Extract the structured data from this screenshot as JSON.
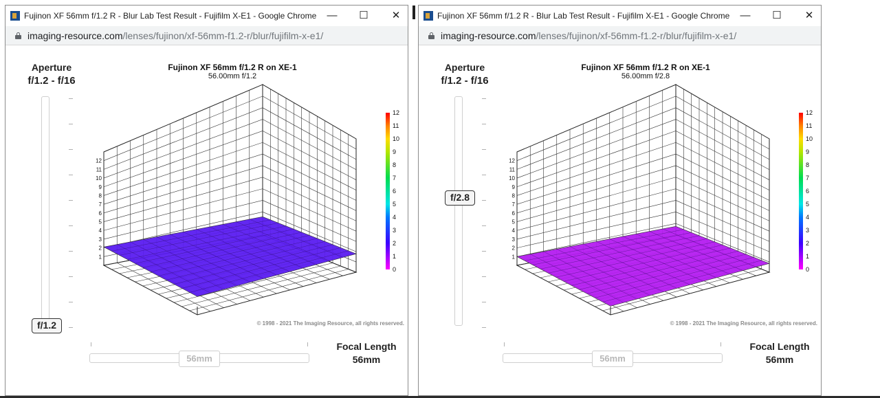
{
  "windows": [
    {
      "title": "Fujinon XF 56mm f/1.2 R - Blur Lab Test Result - Fujifilm X-E1 - Google Chrome",
      "url_host": "imaging-resource.com",
      "url_path": "/lenses/fujinon/xf-56mm-f1.2-r/blur/fujifilm-x-e1/",
      "aperture": {
        "title": "Aperture",
        "range": "f/1.2 - f/16",
        "selected": "f/1.2",
        "slider_fraction": 1.0
      },
      "focal_length": {
        "title": "Focal Length",
        "value": "56mm",
        "handle_label": "56mm"
      },
      "chart_data": {
        "type": "surface3d",
        "title": "Fujinon XF 56mm f/1.2 R on XE-1",
        "subtitle": "56.00mm f/1.2",
        "z_axis_ticks": [
          "1",
          "2",
          "3",
          "4",
          "5",
          "6",
          "7",
          "8",
          "9",
          "10",
          "11",
          "12"
        ],
        "colorbar_ticks": [
          "0",
          "1",
          "2",
          "3",
          "4",
          "5",
          "6",
          "7",
          "8",
          "9",
          "10",
          "11",
          "12"
        ],
        "colorbar_range": [
          0,
          12
        ],
        "surface_level": 2.1,
        "surface_color": "#5a1cf0",
        "grid": true
      },
      "copyright": "© 1998 - 2021 The Imaging Resource, all rights reserved."
    },
    {
      "title": "Fujinon XF 56mm f/1.2 R - Blur Lab Test Result - Fujifilm X-E1 - Google Chrome",
      "url_host": "imaging-resource.com",
      "url_path": "/lenses/fujinon/xf-56mm-f1.2-r/blur/fujifilm-x-e1/",
      "aperture": {
        "title": "Aperture",
        "range": "f/1.2 - f/16",
        "selected": "f/2.8",
        "slider_fraction": 0.43
      },
      "focal_length": {
        "title": "Focal Length",
        "value": "56mm",
        "handle_label": "56mm"
      },
      "chart_data": {
        "type": "surface3d",
        "title": "Fujinon XF 56mm f/1.2 R on XE-1",
        "subtitle": "56.00mm f/2.8",
        "z_axis_ticks": [
          "1",
          "2",
          "3",
          "4",
          "5",
          "6",
          "7",
          "8",
          "9",
          "10",
          "11",
          "12"
        ],
        "colorbar_ticks": [
          "0",
          "1",
          "2",
          "3",
          "4",
          "5",
          "6",
          "7",
          "8",
          "9",
          "10",
          "11",
          "12"
        ],
        "colorbar_range": [
          0,
          12
        ],
        "surface_level": 1.0,
        "surface_color": "#b41cf0",
        "grid": true
      },
      "copyright": "© 1998 - 2021 The Imaging Resource, all rights reserved."
    }
  ],
  "window_controls": {
    "minimize": "—",
    "maximize": "☐",
    "close": "✕"
  },
  "icons": {
    "app": "imaging-resource-icon",
    "lock": "lock-icon"
  }
}
